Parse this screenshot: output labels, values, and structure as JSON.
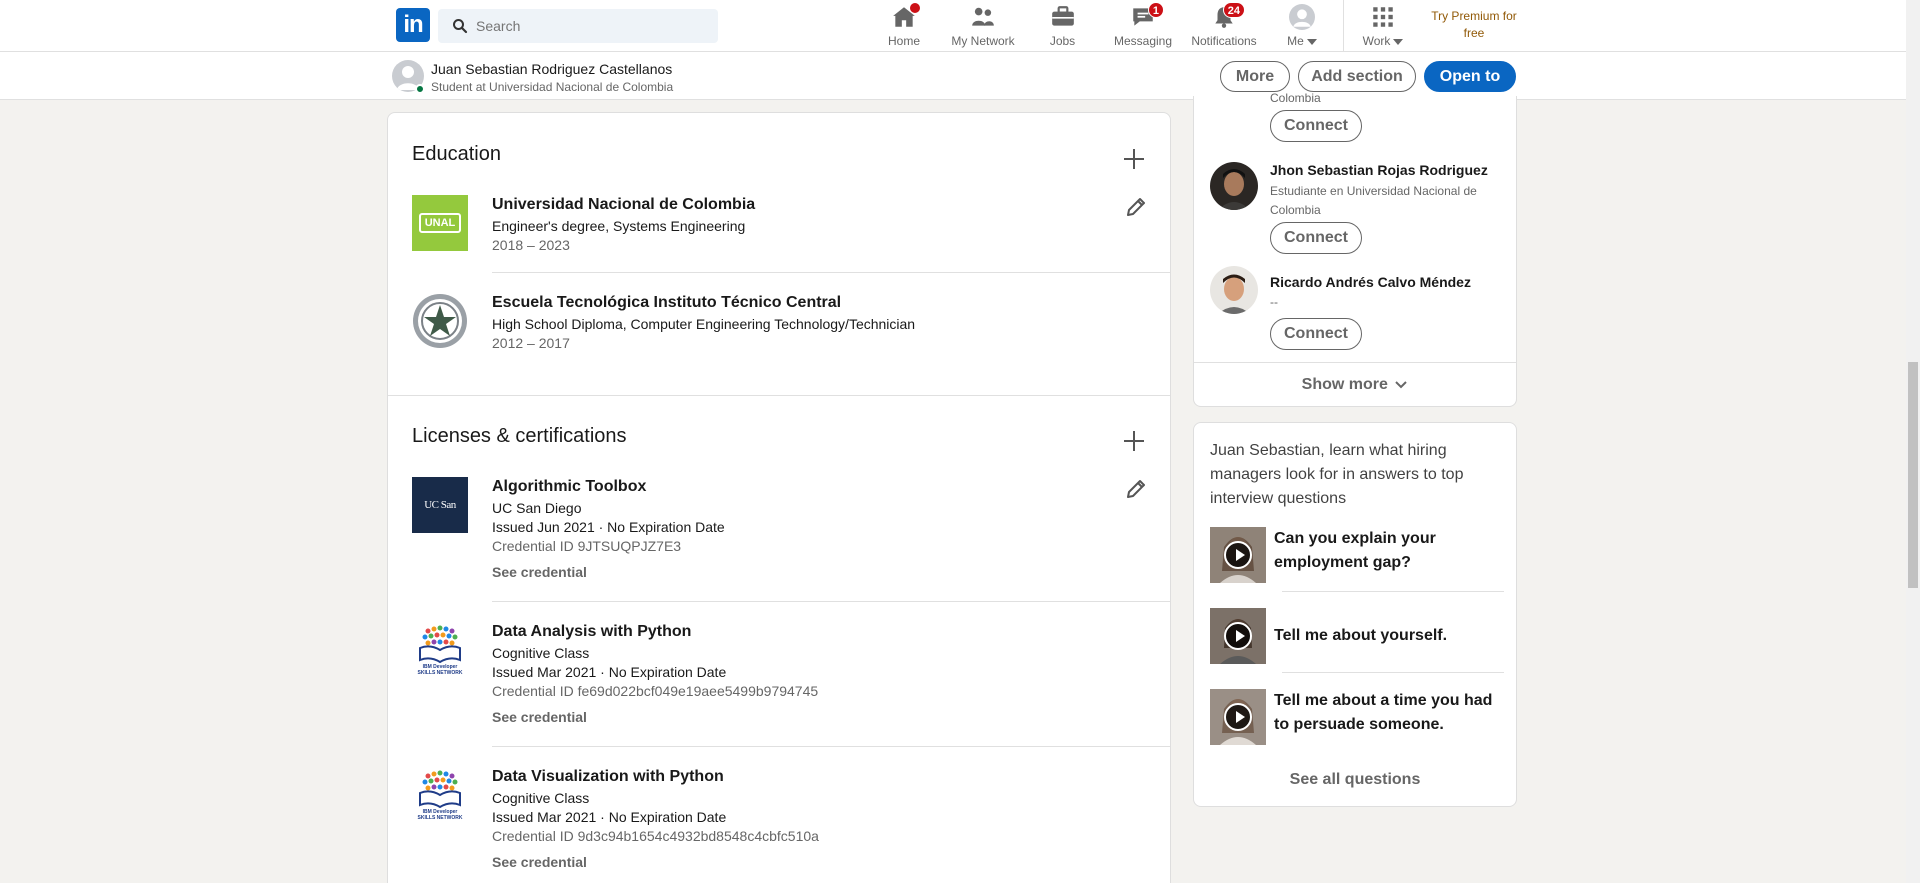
{
  "nav": {
    "logo": "in",
    "search_placeholder": "Search",
    "items": [
      {
        "label": "Home",
        "badge": ""
      },
      {
        "label": "My Network",
        "badge": ""
      },
      {
        "label": "Jobs",
        "badge": ""
      },
      {
        "label": "Messaging",
        "badge": "1"
      },
      {
        "label": "Notifications",
        "badge": "24"
      },
      {
        "label": "Me",
        "badge": ""
      },
      {
        "label": "Work",
        "badge": ""
      }
    ],
    "premium": "Try Premium for free"
  },
  "profile_bar": {
    "name": "Juan Sebastian Rodriguez Castellanos",
    "headline": "Student at Universidad Nacional de Colombia",
    "more": "More",
    "add_section": "Add section",
    "open_to": "Open to"
  },
  "education": {
    "title": "Education",
    "entries": [
      {
        "school": "Universidad Nacional de Colombia",
        "logo_text": "UNAL",
        "degree": "Engineer's degree, Systems Engineering",
        "dates": "2018 – 2023"
      },
      {
        "school": "Escuela Tecnológica Instituto Técnico Central",
        "degree": "High School Diploma, Computer Engineering Technology/Technician",
        "dates": "2012 – 2017"
      }
    ]
  },
  "licenses": {
    "title": "Licenses & certifications",
    "entries": [
      {
        "name": "Algorithmic Toolbox",
        "logo_text": "UC San Diego",
        "issuer": "UC San Diego",
        "issued": "Issued Jun 2021 · No Expiration Date",
        "credential": "Credential ID 9JTSUQPJZ7E3",
        "link": "See credential"
      },
      {
        "name": "Data Analysis with Python",
        "logo_text": "IBM Developer SKILLS NETWORK",
        "issuer": "Cognitive Class",
        "issued": "Issued Mar 2021 · No Expiration Date",
        "credential": "Credential ID fe69d022bcf049e19aee5499b9794745",
        "link": "See credential"
      },
      {
        "name": "Data Visualization with Python",
        "logo_text": "IBM Developer SKILLS NETWORK",
        "issuer": "Cognitive Class",
        "issued": "Issued Mar 2021 · No Expiration Date",
        "credential": "Credential ID 9d3c94b1654c4932bd8548c4cbfc510a",
        "link": "See credential"
      }
    ]
  },
  "people": {
    "partial_head": "Colombia",
    "connect": "Connect",
    "list": [
      {
        "name": "Jhon Sebastian Rojas Rodriguez",
        "headline": "Estudiante en Universidad Nacional de Colombia"
      },
      {
        "name": "Ricardo Andrés Calvo Méndez",
        "headline": "--"
      }
    ],
    "show_more": "Show more"
  },
  "interview": {
    "intro": "Juan Sebastian, learn what hiring managers look for in answers to top interview questions",
    "questions": [
      "Can you explain your employment gap?",
      "Tell me about yourself.",
      "Tell me about a time you had to persuade someone."
    ],
    "see_all": "See all questions"
  }
}
